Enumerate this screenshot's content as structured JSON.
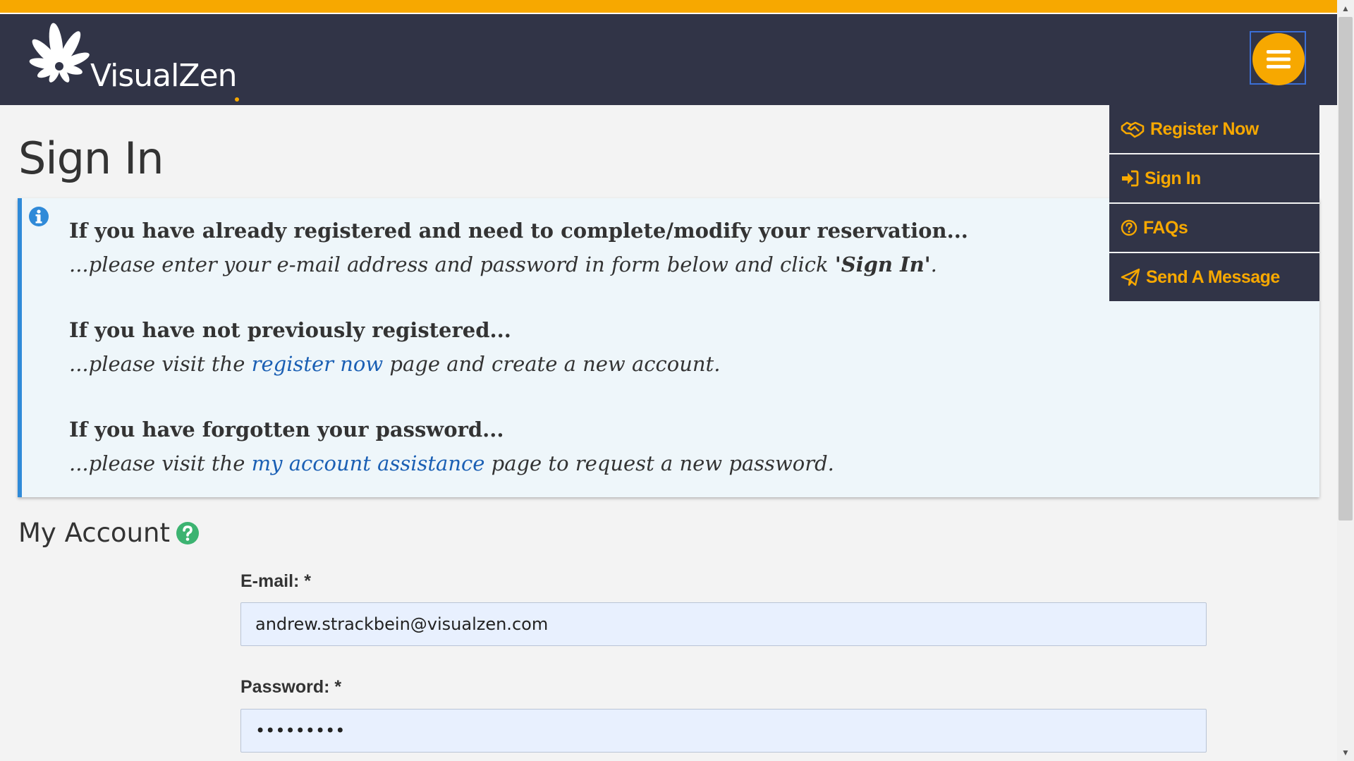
{
  "brand": {
    "name": "VisualZen"
  },
  "menu": {
    "toggle_icon": "hamburger-icon",
    "items": [
      {
        "label": "Register Now",
        "icon": "handshake-icon"
      },
      {
        "label": "Sign In",
        "icon": "sign-in-icon"
      },
      {
        "label": "FAQs",
        "icon": "question-circle-icon"
      },
      {
        "label": "Send A Message",
        "icon": "paper-plane-icon"
      }
    ]
  },
  "page": {
    "title": "Sign In"
  },
  "info": {
    "icon": "info-icon",
    "blocks": [
      {
        "heading": "If you have already registered and need to complete/modify your reservation...",
        "text_before": "...please enter your e-mail address and password in form below and click ",
        "strong": "'Sign In'",
        "text_after": "."
      },
      {
        "heading": "If you have not previously registered...",
        "text_before": "...please visit the ",
        "link": "register now",
        "text_after": " page and create a new account."
      },
      {
        "heading": "If you have forgotten your password...",
        "text_before": "...please visit the ",
        "link": "my account assistance",
        "text_after": " page to request a new password."
      }
    ]
  },
  "account": {
    "title": "My Account",
    "help_icon": "question-circle-icon",
    "email_label": "E-mail: *",
    "email_value": "andrew.strackbein@visualzen.com",
    "password_label": "Password: *",
    "password_value": "•••••••••"
  },
  "colors": {
    "accent": "#f7a800",
    "header": "#313447",
    "link": "#1a5fb4",
    "info_border": "#2f8ad8",
    "help_green": "#3cb371"
  }
}
